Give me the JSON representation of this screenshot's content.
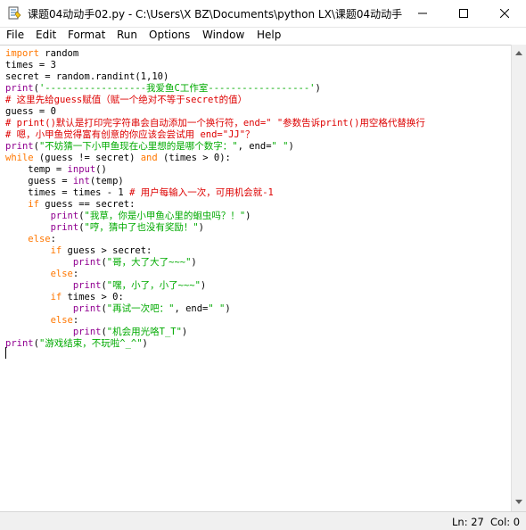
{
  "window": {
    "title": "课题04动动手02.py - C:\\Users\\X BZ\\Documents\\python LX\\课题04动动手..."
  },
  "menu": [
    "File",
    "Edit",
    "Format",
    "Run",
    "Options",
    "Window",
    "Help"
  ],
  "code_lines": [
    [
      {
        "t": "import",
        "c": "kw"
      },
      {
        "t": " random",
        "c": ""
      }
    ],
    [
      {
        "t": "times = 3",
        "c": ""
      }
    ],
    [
      {
        "t": "secret = random.randint(1,10)",
        "c": ""
      }
    ],
    [
      {
        "t": "print",
        "c": "bi"
      },
      {
        "t": "(",
        "c": ""
      },
      {
        "t": "'------------------我爱鱼C工作室------------------'",
        "c": "str"
      },
      {
        "t": ")",
        "c": ""
      }
    ],
    [
      {
        "t": "# 这里先给guess赋值（赋一个绝对不等于secret的值）",
        "c": "cmt"
      }
    ],
    [
      {
        "t": "guess = 0",
        "c": ""
      }
    ],
    [
      {
        "t": "# print()默认是打印完字符串会自动添加一个换行符，end=\" \"参数告诉print()用空格代替换行",
        "c": "cmt"
      }
    ],
    [
      {
        "t": "# 嗯，小甲鱼觉得富有创意的你应该会尝试用 end=\"JJ\"？",
        "c": "cmt"
      }
    ],
    [
      {
        "t": "print",
        "c": "bi"
      },
      {
        "t": "(",
        "c": ""
      },
      {
        "t": "\"不妨猜一下小甲鱼现在心里想的是哪个数字：\"",
        "c": "str"
      },
      {
        "t": ", end=",
        "c": ""
      },
      {
        "t": "\" \"",
        "c": "str"
      },
      {
        "t": ")",
        "c": ""
      }
    ],
    [
      {
        "t": "while",
        "c": "kw"
      },
      {
        "t": " (guess != secret) ",
        "c": ""
      },
      {
        "t": "and",
        "c": "kw"
      },
      {
        "t": " (times > 0):",
        "c": ""
      }
    ],
    [
      {
        "t": "    temp = ",
        "c": ""
      },
      {
        "t": "input",
        "c": "bi"
      },
      {
        "t": "()",
        "c": ""
      }
    ],
    [
      {
        "t": "    guess = ",
        "c": ""
      },
      {
        "t": "int",
        "c": "bi"
      },
      {
        "t": "(temp)",
        "c": ""
      }
    ],
    [
      {
        "t": "    times = times - 1 ",
        "c": ""
      },
      {
        "t": "# 用户每输入一次，可用机会就-1",
        "c": "cmt"
      }
    ],
    [
      {
        "t": "    ",
        "c": ""
      },
      {
        "t": "if",
        "c": "kw"
      },
      {
        "t": " guess == secret:",
        "c": ""
      }
    ],
    [
      {
        "t": "        ",
        "c": ""
      },
      {
        "t": "print",
        "c": "bi"
      },
      {
        "t": "(",
        "c": ""
      },
      {
        "t": "\"我草，你是小甲鱼心里的蛔虫吗？！\"",
        "c": "str"
      },
      {
        "t": ")",
        "c": ""
      }
    ],
    [
      {
        "t": "        ",
        "c": ""
      },
      {
        "t": "print",
        "c": "bi"
      },
      {
        "t": "(",
        "c": ""
      },
      {
        "t": "\"哼，猜中了也没有奖励！\"",
        "c": "str"
      },
      {
        "t": ")",
        "c": ""
      }
    ],
    [
      {
        "t": "    ",
        "c": ""
      },
      {
        "t": "else",
        "c": "kw"
      },
      {
        "t": ":",
        "c": ""
      }
    ],
    [
      {
        "t": "        ",
        "c": ""
      },
      {
        "t": "if",
        "c": "kw"
      },
      {
        "t": " guess > secret:",
        "c": ""
      }
    ],
    [
      {
        "t": "            ",
        "c": ""
      },
      {
        "t": "print",
        "c": "bi"
      },
      {
        "t": "(",
        "c": ""
      },
      {
        "t": "\"哥，大了大了~~~\"",
        "c": "str"
      },
      {
        "t": ")",
        "c": ""
      }
    ],
    [
      {
        "t": "        ",
        "c": ""
      },
      {
        "t": "else",
        "c": "kw"
      },
      {
        "t": ":",
        "c": ""
      }
    ],
    [
      {
        "t": "            ",
        "c": ""
      },
      {
        "t": "print",
        "c": "bi"
      },
      {
        "t": "(",
        "c": ""
      },
      {
        "t": "\"嘿，小了，小了~~~\"",
        "c": "str"
      },
      {
        "t": ")",
        "c": ""
      }
    ],
    [
      {
        "t": "        ",
        "c": ""
      },
      {
        "t": "if",
        "c": "kw"
      },
      {
        "t": " times > 0:",
        "c": ""
      }
    ],
    [
      {
        "t": "            ",
        "c": ""
      },
      {
        "t": "print",
        "c": "bi"
      },
      {
        "t": "(",
        "c": ""
      },
      {
        "t": "\"再试一次吧：\"",
        "c": "str"
      },
      {
        "t": ", end=",
        "c": ""
      },
      {
        "t": "\" \"",
        "c": "str"
      },
      {
        "t": ")",
        "c": ""
      }
    ],
    [
      {
        "t": "        ",
        "c": ""
      },
      {
        "t": "else",
        "c": "kw"
      },
      {
        "t": ":",
        "c": ""
      }
    ],
    [
      {
        "t": "            ",
        "c": ""
      },
      {
        "t": "print",
        "c": "bi"
      },
      {
        "t": "(",
        "c": ""
      },
      {
        "t": "\"机会用光咯T_T\"",
        "c": "str"
      },
      {
        "t": ")",
        "c": ""
      }
    ],
    [
      {
        "t": "print",
        "c": "bi"
      },
      {
        "t": "(",
        "c": ""
      },
      {
        "t": "\"游戏结束，不玩啦^_^\"",
        "c": "str"
      },
      {
        "t": ")",
        "c": ""
      }
    ]
  ],
  "status": {
    "line": "Ln: 27",
    "col": "Col: 0"
  },
  "colors": {
    "keyword": "#ff7700",
    "builtin": "#900090",
    "string": "#00aa00",
    "comment": "#dd0000"
  },
  "icons": [
    "idle-app-icon",
    "minimize-icon",
    "maximize-icon",
    "close-icon",
    "scroll-up-arrow-icon",
    "scroll-down-arrow-icon"
  ]
}
